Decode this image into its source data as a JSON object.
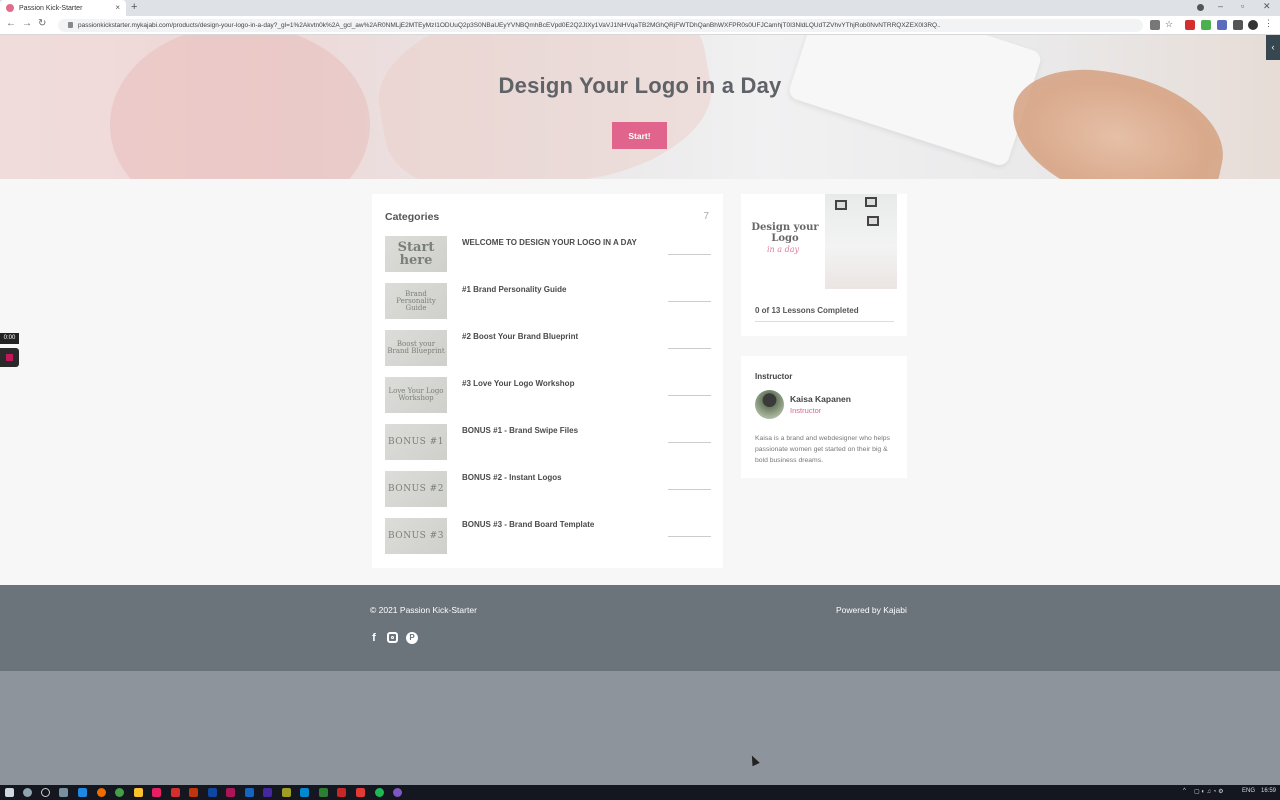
{
  "browser": {
    "tab_title": "Passion Kick-Starter",
    "tab_close": "×",
    "new_tab": "+",
    "url": "passionkickstarter.mykajabi.com/products/design-your-logo-in-a-day?_gl=1%2Akvtn0k%2A_gcl_aw%2AR0NMLjE2MTEyMzI1ODUuQ2p3S0NBaUEyYVNBQmhBcEVpd0E2Q2JtXy1VaVJ1NHVqaTB2MGhQRjFWTDhQanBhWXFPR0s0UFJCamhjT0I3NldLQUdTZVhvYThjRob0NvNTRRQXZEX0I3RQ.."
  },
  "hero": {
    "title": "Design Your Logo in a Day",
    "start_label": "Start!"
  },
  "categories": {
    "title": "Categories",
    "count": "7",
    "items": [
      {
        "label": "WELCOME TO DESIGN YOUR LOGO IN A DAY",
        "thumb_text": "Start here"
      },
      {
        "label": "#1 Brand Personality Guide",
        "thumb_text": "Brand Personality Guide"
      },
      {
        "label": "#2 Boost Your Brand Blueprint",
        "thumb_text": "Boost your Brand Blueprint"
      },
      {
        "label": "#3 Love Your Logo Workshop",
        "thumb_text": "Love Your Logo Workshop"
      },
      {
        "label": "BONUS #1 - Brand Swipe Files",
        "thumb_text": "BONUS #1"
      },
      {
        "label": "BONUS #2 - Instant Logos",
        "thumb_text": "BONUS #2"
      },
      {
        "label": "BONUS #3 - Brand Board Template",
        "thumb_text": "BONUS #3"
      }
    ]
  },
  "product": {
    "image_title": "Design your Logo",
    "image_script": "in a day",
    "progress_label": "0 of 13 Lessons Completed",
    "progress_fraction": 0
  },
  "instructor": {
    "heading": "Instructor",
    "name": "Kaisa Kapanen",
    "role": "Instructor",
    "bio": "Kaisa is a brand and webdesigner who helps passionate women get started on their big & bold business dreams."
  },
  "video_widget": {
    "time": "0:00"
  },
  "footer": {
    "copyright": "© 2021 Passion Kick-Starter",
    "powered_by": "Powered by Kajabi"
  },
  "taskbar": {
    "lang": "ENG",
    "time": "16:59"
  },
  "colors": {
    "accent": "#e0648b",
    "footer_bg": "#6b737b"
  }
}
